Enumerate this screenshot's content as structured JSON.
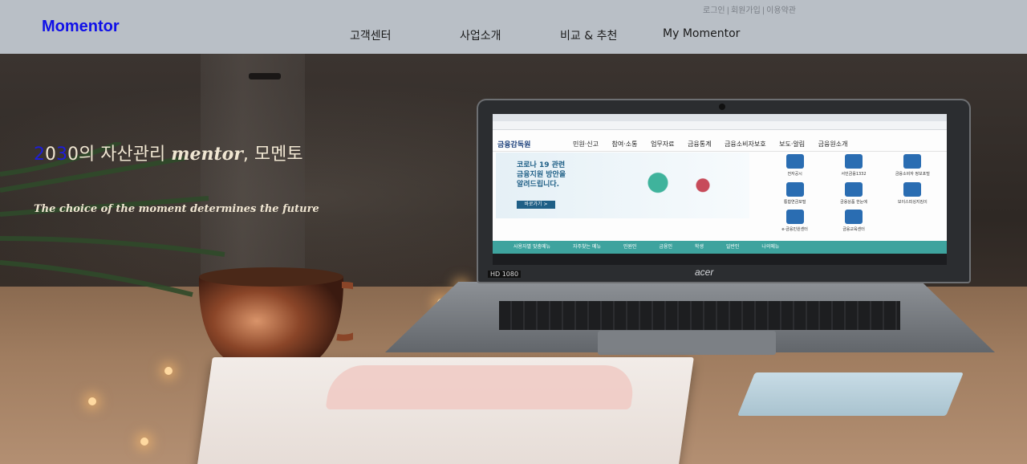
{
  "header": {
    "logo": "Momentor",
    "util_links": [
      "로그인",
      "회원가입",
      "이용약관"
    ],
    "util_separator": "|",
    "nav": [
      "고객센터",
      "사업소개",
      "비교 & 추천",
      "My Momentor"
    ]
  },
  "hero": {
    "tagline_digit_1": "2",
    "tagline_digit_2": "0",
    "tagline_digit_3": "3",
    "tagline_digit_4": "0",
    "tagline_mid": "의 자산관리 ",
    "tagline_brand": "mentor",
    "tagline_end": ", 모멘토",
    "subline": "The choice of the moment determines the future",
    "laptop_brand": "acer",
    "screen": {
      "site_logo": "금융감독원",
      "menu": [
        "민원·신고",
        "참여·소통",
        "업무자료",
        "금융통계",
        "금융소비자보호",
        "보도·알림",
        "금융원소개"
      ],
      "banner_lines": [
        "코로나 19 관련",
        "금융지원 방안을",
        "알려드립니다."
      ],
      "banner_button": "바로가기 >",
      "quick_items": [
        "전자공시",
        "서민금융1332",
        "금융소비자 정보포털",
        "통합연금포털",
        "금융상품 한눈에",
        "보이스피싱지킴이",
        "e-금융민원센터",
        "금융교육센터"
      ],
      "footer_items": [
        "사용자별 맞춤메뉴",
        "자주찾는 메뉴",
        "민원인",
        "금융인",
        "학생",
        "일반인",
        "나의메뉴"
      ],
      "bezel_label": "HD 1080"
    }
  },
  "colors": {
    "header_bg": "#b9bfc6",
    "logo": "#1010e8",
    "tagline_highlight": "#1e1ed8",
    "tagline_text": "#f0e6d2"
  }
}
